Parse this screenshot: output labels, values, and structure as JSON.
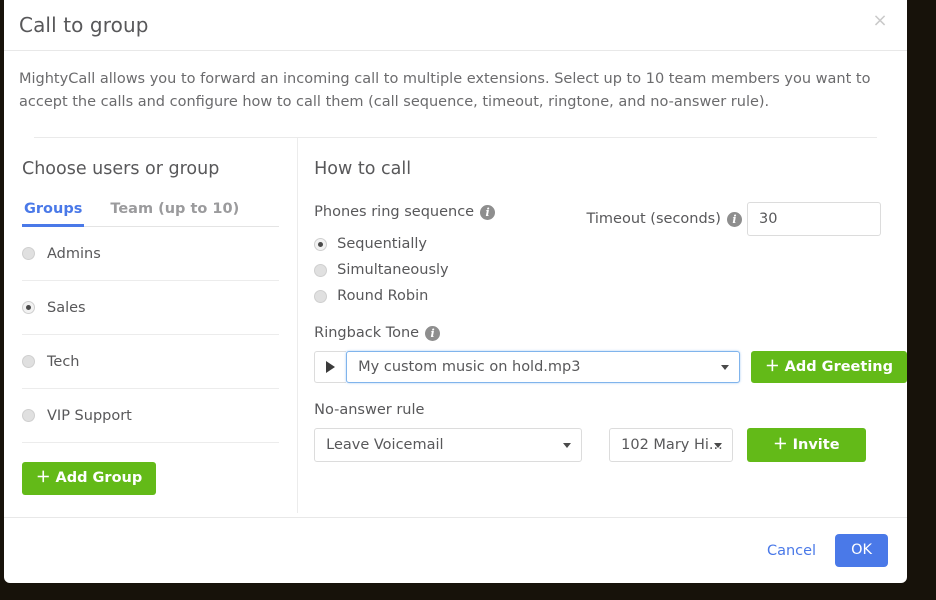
{
  "modal": {
    "title": "Call to group",
    "close_label": "×",
    "description": "MightyCall allows you to forward an incoming call to multiple extensions. Select up to 10 team members you want to accept the calls and configure how to call them (call sequence, timeout, ringtone, and no-answer rule).",
    "footer": {
      "cancel_label": "Cancel",
      "ok_label": "OK"
    }
  },
  "left": {
    "heading": "Choose users or group",
    "tabs": [
      {
        "label": "Groups",
        "active": true
      },
      {
        "label": "Team (up to 10)",
        "active": false
      }
    ],
    "groups": [
      {
        "label": "Admins",
        "selected": false
      },
      {
        "label": "Sales",
        "selected": true
      },
      {
        "label": "Tech",
        "selected": false
      },
      {
        "label": "VIP Support",
        "selected": false
      }
    ],
    "add_group_label": "Add Group",
    "plus": "＋"
  },
  "right": {
    "heading": "How to call",
    "ring_sequence_label": "Phones ring sequence",
    "info_glyph": "i",
    "ring_options": [
      {
        "label": "Sequentially",
        "selected": true
      },
      {
        "label": "Simultaneously",
        "selected": false
      },
      {
        "label": "Round Robin",
        "selected": false
      }
    ],
    "timeout_label": "Timeout (seconds)",
    "timeout_value": "30",
    "timeout_placeholder": "30",
    "ringback_label": "Ringback Tone",
    "ringback_value": "My custom music on hold.mp3",
    "play_icon": "play-icon",
    "add_greeting_label": "Add Greeting",
    "noanswer_label": "No-answer rule",
    "noanswer_value": "Leave Voicemail",
    "extension_value": "102 Mary Hi...",
    "invite_label": "Invite"
  },
  "colors": {
    "accent_blue": "#4a79e8",
    "accent_green": "#63ba18",
    "text_gray": "#58585a",
    "backdrop": "#17120a"
  }
}
